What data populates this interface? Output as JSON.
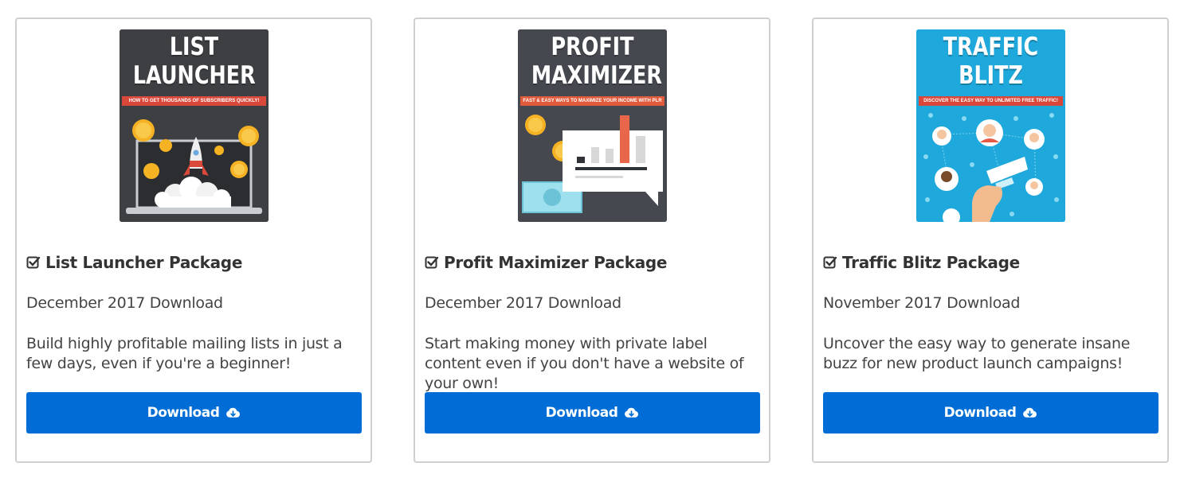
{
  "cards": [
    {
      "cover_title": "LIST LAUNCHER",
      "cover_title_line1": "LIST",
      "cover_title_line2": "LAUNCHER",
      "cover_banner": "HOW TO GET THOUSANDS OF SUBSCRIBERS QUICKLY!",
      "cover_bg": "#3d3f43",
      "banner_color": "#d9493b",
      "title": "List Launcher Package",
      "date": "December 2017 Download",
      "description": "Build highly profitable mailing lists in just a few days, even if you're a beginner!",
      "button_label": "Download"
    },
    {
      "cover_title": "PROFIT MAXIMIZER",
      "cover_title_line1": "PROFIT",
      "cover_title_line2": "MAXIMIZER",
      "cover_banner": "FAST & EASY WAYS TO MAXIMIZE YOUR INCOME WITH PLR",
      "cover_bg": "#45494f",
      "banner_color": "#e05a3c",
      "title": "Profit Maximizer Package",
      "date": "December 2017 Download",
      "description": "Start making money with private label content even if you don't have a website of your own!",
      "button_label": "Download"
    },
    {
      "cover_title": "TRAFFIC BLITZ",
      "cover_title_line1": "TRAFFIC",
      "cover_title_line2": "BLITZ",
      "cover_banner": "DISCOVER THE EASY WAY TO UNLIMITED FREE TRAFFIC!",
      "cover_bg": "#1fa8dc",
      "banner_color": "#d9463a",
      "title": "Traffic Blitz Package",
      "date": "November 2017 Download",
      "description": "Uncover the easy way to generate insane buzz for new product launch campaigns!",
      "button_label": "Download"
    }
  ],
  "colors": {
    "button": "#006dd6",
    "border": "#cfcfcf"
  }
}
